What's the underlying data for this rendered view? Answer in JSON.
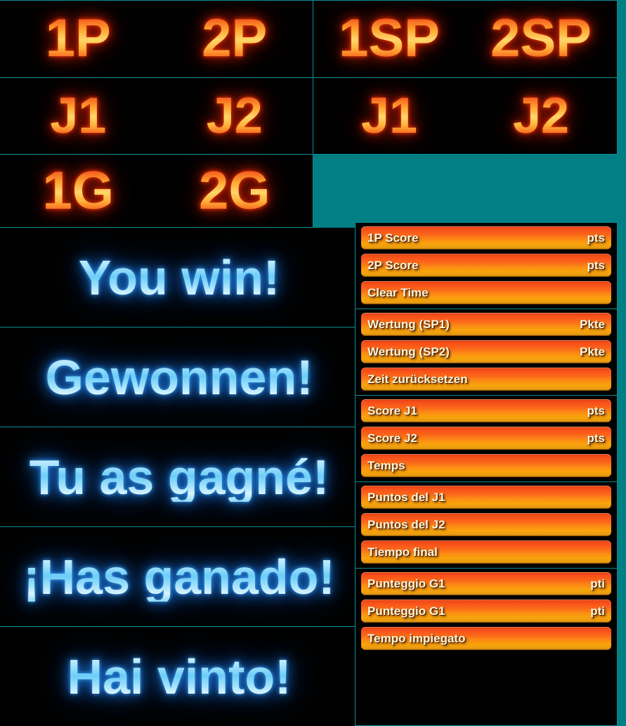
{
  "theme": {
    "background": "#007f85",
    "panel_background": "#000000",
    "grid_line": "#0d8e94",
    "orange_text_accent": "#ff9a2a",
    "blue_text_accent": "#8ed8f8",
    "bar_top": "#ef4a18",
    "bar_bottom": "#f9a30c",
    "bar_text": "#fdf6d8"
  },
  "player_labels": {
    "row1": {
      "left": [
        "1P",
        "2P"
      ],
      "right": [
        "1SP",
        "2SP"
      ]
    },
    "row2": {
      "left": [
        "J1",
        "J2"
      ],
      "right": [
        "J1",
        "J2"
      ]
    },
    "row3": {
      "left": [
        "1G",
        "2G"
      ]
    }
  },
  "win_messages": [
    {
      "language": "English",
      "text": "You win!"
    },
    {
      "language": "German",
      "text": "Gewonnen!"
    },
    {
      "language": "French",
      "text": "Tu as gagné!"
    },
    {
      "language": "Spanish",
      "text": "¡Has ganado!"
    },
    {
      "language": "Italian",
      "text": "Hai vinto!"
    }
  ],
  "score_groups": [
    {
      "language": "English",
      "bars": [
        {
          "label": "1P Score",
          "unit": "pts"
        },
        {
          "label": "2P Score",
          "unit": "pts"
        },
        {
          "label": "Clear Time",
          "unit": ""
        }
      ]
    },
    {
      "language": "German",
      "bars": [
        {
          "label": "Wertung (SP1)",
          "unit": "Pkte"
        },
        {
          "label": "Wertung (SP2)",
          "unit": "Pkte"
        },
        {
          "label": "Zeit zurücksetzen",
          "unit": ""
        }
      ]
    },
    {
      "language": "French",
      "bars": [
        {
          "label": "Score J1",
          "unit": "pts"
        },
        {
          "label": "Score J2",
          "unit": "pts"
        },
        {
          "label": "Temps",
          "unit": ""
        }
      ]
    },
    {
      "language": "Spanish",
      "bars": [
        {
          "label": "Puntos del J1",
          "unit": ""
        },
        {
          "label": "Puntos del J2",
          "unit": ""
        },
        {
          "label": "Tiempo final",
          "unit": ""
        }
      ]
    },
    {
      "language": "Italian",
      "bars": [
        {
          "label": "Punteggio G1",
          "unit": "pti"
        },
        {
          "label": "Punteggio G1",
          "unit": "pti"
        },
        {
          "label": "Tempo impiegato",
          "unit": ""
        }
      ]
    }
  ]
}
